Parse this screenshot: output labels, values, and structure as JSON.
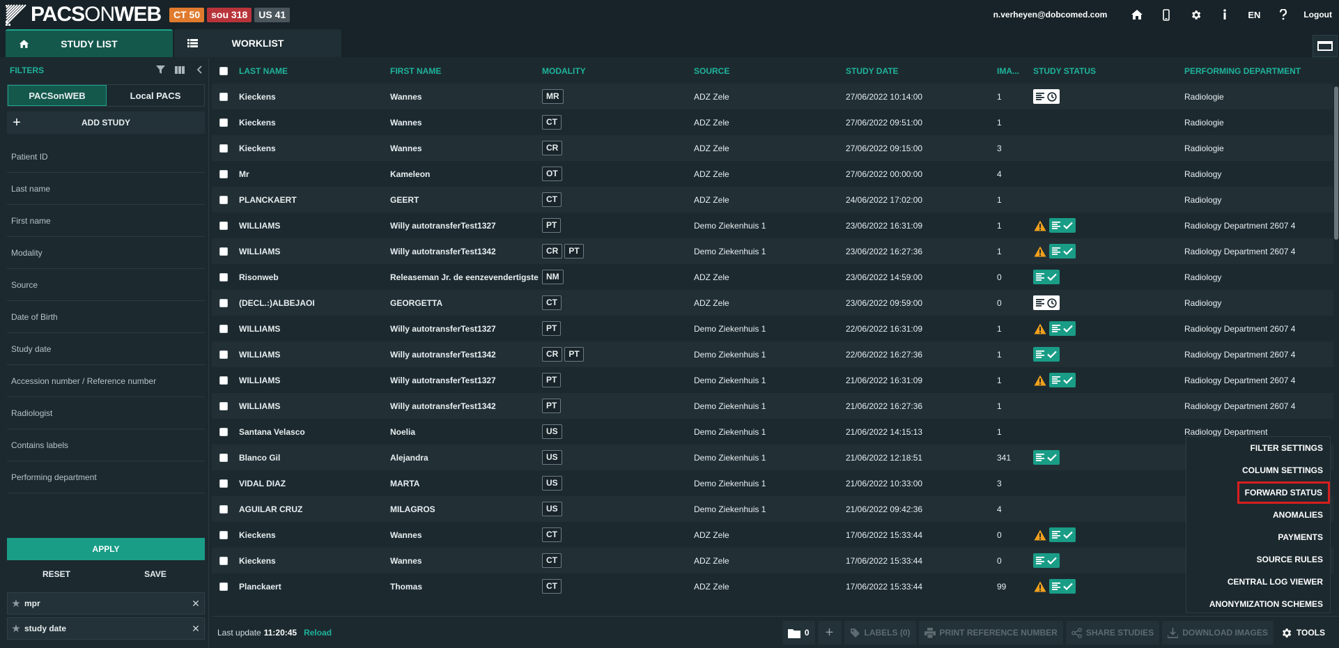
{
  "app": {
    "logo_prefix": "PACS",
    "logo_on": "ON",
    "logo_suffix": "WEB",
    "badges": [
      {
        "label": "CT 50",
        "color": "#e07b2e"
      },
      {
        "label": "sou 318",
        "color": "#b8343a"
      },
      {
        "label": "US 41",
        "color": "#4a565c"
      }
    ]
  },
  "header": {
    "user_email": "n.verheyen@dobcomed.com",
    "language": "EN",
    "logout_label": "Logout",
    "icons": [
      "home-icon",
      "mobile-icon",
      "gear-icon",
      "info-icon",
      "help-icon"
    ]
  },
  "tabs": [
    {
      "label": "STUDY LIST",
      "icon": "home-icon",
      "active": true
    },
    {
      "label": "WORKLIST",
      "icon": "list-icon",
      "active": false
    }
  ],
  "filters": {
    "title": "FILTERS",
    "sources": [
      "PACSonWEB",
      "Local PACS"
    ],
    "active_source": "PACSonWEB",
    "add_study_label": "ADD STUDY",
    "fields": [
      "Patient ID",
      "Last name",
      "First name",
      "Modality",
      "Source",
      "Date of Birth",
      "Study date",
      "Accession number / Reference number",
      "Radiologist",
      "Contains labels",
      "Performing department"
    ],
    "apply_label": "APPLY",
    "reset_label": "RESET",
    "save_label": "SAVE",
    "saved_filters": [
      "mpr",
      "study date"
    ]
  },
  "table": {
    "columns": [
      "LAST NAME",
      "FIRST NAME",
      "MODALITY",
      "SOURCE",
      "STUDY DATE",
      "IMA...",
      "STUDY STATUS",
      "PERFORMING DEPARTMENT"
    ],
    "rows": [
      {
        "last": "Kieckens",
        "first": "Wannes",
        "modality": [
          "MR"
        ],
        "source": "ADZ Zele",
        "date": "27/06/2022 10:14:00",
        "images": "1",
        "status": {
          "warn": false,
          "type": "pending"
        },
        "dept": "Radiologie"
      },
      {
        "last": "Kieckens",
        "first": "Wannes",
        "modality": [
          "CT"
        ],
        "source": "ADZ Zele",
        "date": "27/06/2022 09:51:00",
        "images": "1",
        "status": {
          "warn": false,
          "type": "none"
        },
        "dept": "Radiologie"
      },
      {
        "last": "Kieckens",
        "first": "Wannes",
        "modality": [
          "CR"
        ],
        "source": "ADZ Zele",
        "date": "27/06/2022 09:15:00",
        "images": "3",
        "status": {
          "warn": false,
          "type": "none"
        },
        "dept": "Radiologie"
      },
      {
        "last": "Mr",
        "first": "Kameleon",
        "modality": [
          "OT"
        ],
        "source": "ADZ Zele",
        "date": "27/06/2022 00:00:00",
        "images": "4",
        "status": {
          "warn": false,
          "type": "none"
        },
        "dept": "Radiology"
      },
      {
        "last": "PLANCKAERT",
        "first": "GEERT",
        "modality": [
          "CT"
        ],
        "source": "ADZ Zele",
        "date": "24/06/2022 17:02:00",
        "images": "1",
        "status": {
          "warn": false,
          "type": "none"
        },
        "dept": "Radiology"
      },
      {
        "last": "WILLIAMS",
        "first": "Willy autotransferTest1327",
        "modality": [
          "PT"
        ],
        "source": "Demo Ziekenhuis 1",
        "date": "23/06/2022 16:31:09",
        "images": "1",
        "status": {
          "warn": true,
          "type": "done"
        },
        "dept": "Radiology Department 2607 4"
      },
      {
        "last": "WILLIAMS",
        "first": "Willy autotransferTest1342",
        "modality": [
          "CR",
          "PT"
        ],
        "source": "Demo Ziekenhuis 1",
        "date": "23/06/2022 16:27:36",
        "images": "1",
        "status": {
          "warn": true,
          "type": "done"
        },
        "dept": "Radiology Department 2607 4"
      },
      {
        "last": "Risonweb",
        "first": "Releaseman Jr. de eenzevendertigste",
        "modality": [
          "NM"
        ],
        "source": "ADZ Zele",
        "date": "23/06/2022 14:59:00",
        "images": "0",
        "status": {
          "warn": false,
          "type": "done"
        },
        "dept": "Radiology"
      },
      {
        "last": "(DECL.:)ALBEJAOI",
        "first": "GEORGETTA",
        "modality": [
          "CT"
        ],
        "source": "ADZ Zele",
        "date": "23/06/2022 09:59:00",
        "images": "0",
        "status": {
          "warn": false,
          "type": "pending"
        },
        "dept": "Radiology"
      },
      {
        "last": "WILLIAMS",
        "first": "Willy autotransferTest1327",
        "modality": [
          "PT"
        ],
        "source": "Demo Ziekenhuis 1",
        "date": "22/06/2022 16:31:09",
        "images": "1",
        "status": {
          "warn": true,
          "type": "done"
        },
        "dept": "Radiology Department 2607 4"
      },
      {
        "last": "WILLIAMS",
        "first": "Willy autotransferTest1342",
        "modality": [
          "CR",
          "PT"
        ],
        "source": "Demo Ziekenhuis 1",
        "date": "22/06/2022 16:27:36",
        "images": "1",
        "status": {
          "warn": false,
          "type": "done"
        },
        "dept": "Radiology Department 2607 4"
      },
      {
        "last": "WILLIAMS",
        "first": "Willy autotransferTest1327",
        "modality": [
          "PT"
        ],
        "source": "Demo Ziekenhuis 1",
        "date": "21/06/2022 16:31:09",
        "images": "1",
        "status": {
          "warn": true,
          "type": "done"
        },
        "dept": "Radiology Department 2607 4"
      },
      {
        "last": "WILLIAMS",
        "first": "Willy autotransferTest1342",
        "modality": [
          "PT"
        ],
        "source": "Demo Ziekenhuis 1",
        "date": "21/06/2022 16:27:36",
        "images": "1",
        "status": {
          "warn": false,
          "type": "none"
        },
        "dept": "Radiology Department 2607 4"
      },
      {
        "last": "Santana Velasco",
        "first": "Noelia",
        "modality": [
          "US"
        ],
        "source": "Demo Ziekenhuis 1",
        "date": "21/06/2022 14:15:13",
        "images": "1",
        "status": {
          "warn": false,
          "type": "none"
        },
        "dept": "Radiology Department"
      },
      {
        "last": "Blanco Gil",
        "first": "Alejandra",
        "modality": [
          "US"
        ],
        "source": "Demo Ziekenhuis 1",
        "date": "21/06/2022 12:18:51",
        "images": "341",
        "status": {
          "warn": false,
          "type": "done"
        },
        "dept": ""
      },
      {
        "last": "VIDAL DIAZ",
        "first": "MARTA",
        "modality": [
          "US"
        ],
        "source": "Demo Ziekenhuis 1",
        "date": "21/06/2022 10:33:00",
        "images": "3",
        "status": {
          "warn": false,
          "type": "none"
        },
        "dept": ""
      },
      {
        "last": "AGUILAR CRUZ",
        "first": "MILAGROS",
        "modality": [
          "US"
        ],
        "source": "Demo Ziekenhuis 1",
        "date": "21/06/2022 09:42:36",
        "images": "4",
        "status": {
          "warn": false,
          "type": "none"
        },
        "dept": ""
      },
      {
        "last": "Kieckens",
        "first": "Wannes",
        "modality": [
          "CT"
        ],
        "source": "ADZ Zele",
        "date": "17/06/2022 15:33:44",
        "images": "0",
        "status": {
          "warn": true,
          "type": "done"
        },
        "dept": ""
      },
      {
        "last": "Kieckens",
        "first": "Wannes",
        "modality": [
          "CT"
        ],
        "source": "ADZ Zele",
        "date": "17/06/2022 15:33:44",
        "images": "0",
        "status": {
          "warn": false,
          "type": "done"
        },
        "dept": ""
      },
      {
        "last": "Planckaert",
        "first": "Thomas",
        "modality": [
          "CT"
        ],
        "source": "ADZ Zele",
        "date": "17/06/2022 15:33:44",
        "images": "99",
        "status": {
          "warn": true,
          "type": "done"
        },
        "dept": ""
      }
    ]
  },
  "bottom": {
    "last_update_label": "Last update",
    "last_update_time": "11:20:45",
    "reload_label": "Reload",
    "folder_count": "0",
    "labels_label": "LABELS (0)",
    "print_label": "PRINT REFERENCE NUMBER",
    "share_label": "SHARE STUDIES",
    "download_label": "DOWNLOAD IMAGES",
    "tools_label": "TOOLS"
  },
  "tools_menu": {
    "items": [
      "FILTER SETTINGS",
      "COLUMN SETTINGS",
      "FORWARD STATUS",
      "ANOMALIES",
      "PAYMENTS",
      "SOURCE RULES",
      "CENTRAL LOG VIEWER",
      "ANONYMIZATION SCHEMES"
    ],
    "highlighted": "FORWARD STATUS"
  },
  "colors": {
    "accent": "#1fb39a",
    "active_tab": "#14584c",
    "status_green": "#1a9d87",
    "warning": "#f2a01c",
    "highlight_border": "#d81e1e"
  }
}
